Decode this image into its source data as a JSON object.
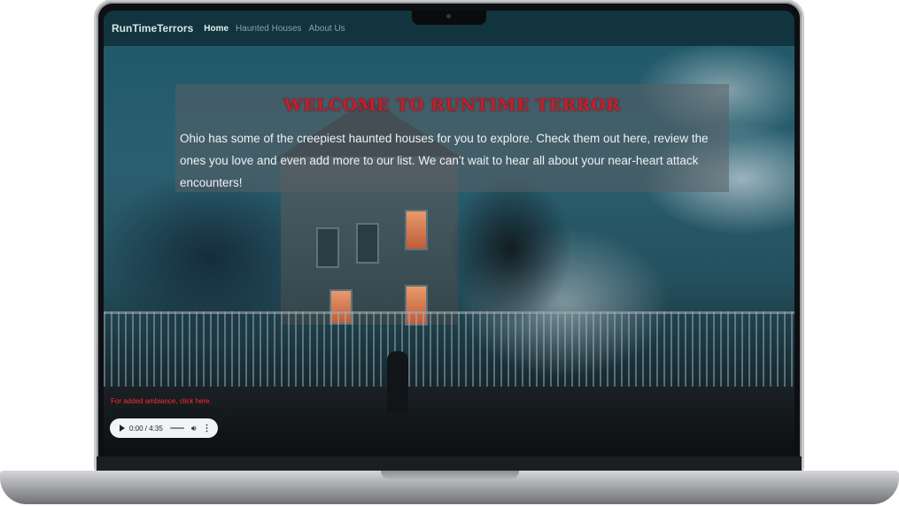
{
  "navbar": {
    "brand": "RunTimeTerrors",
    "links": [
      {
        "label": "Home",
        "active": true
      },
      {
        "label": "Haunted Houses",
        "active": false
      },
      {
        "label": "About Us",
        "active": false
      }
    ]
  },
  "hero": {
    "title": "WELCOME TO RUNTIME TERROR",
    "text": "Ohio has some of the creepiest haunted houses for you to explore. Check them out here, review the ones you love and even add more to our list. We can't wait to hear all about your near-heart attack encounters!"
  },
  "ambiance": {
    "prompt": "For added ambiance, click here.",
    "player": {
      "time": "0:00 / 4:35",
      "play_icon": "play-icon",
      "volume_icon": "volume-icon",
      "menu_icon": "more-vertical-icon"
    }
  },
  "colors": {
    "accent_red": "#c21f2c",
    "ambiance_red": "#ff2a2a",
    "navbar": "#0e2832"
  }
}
